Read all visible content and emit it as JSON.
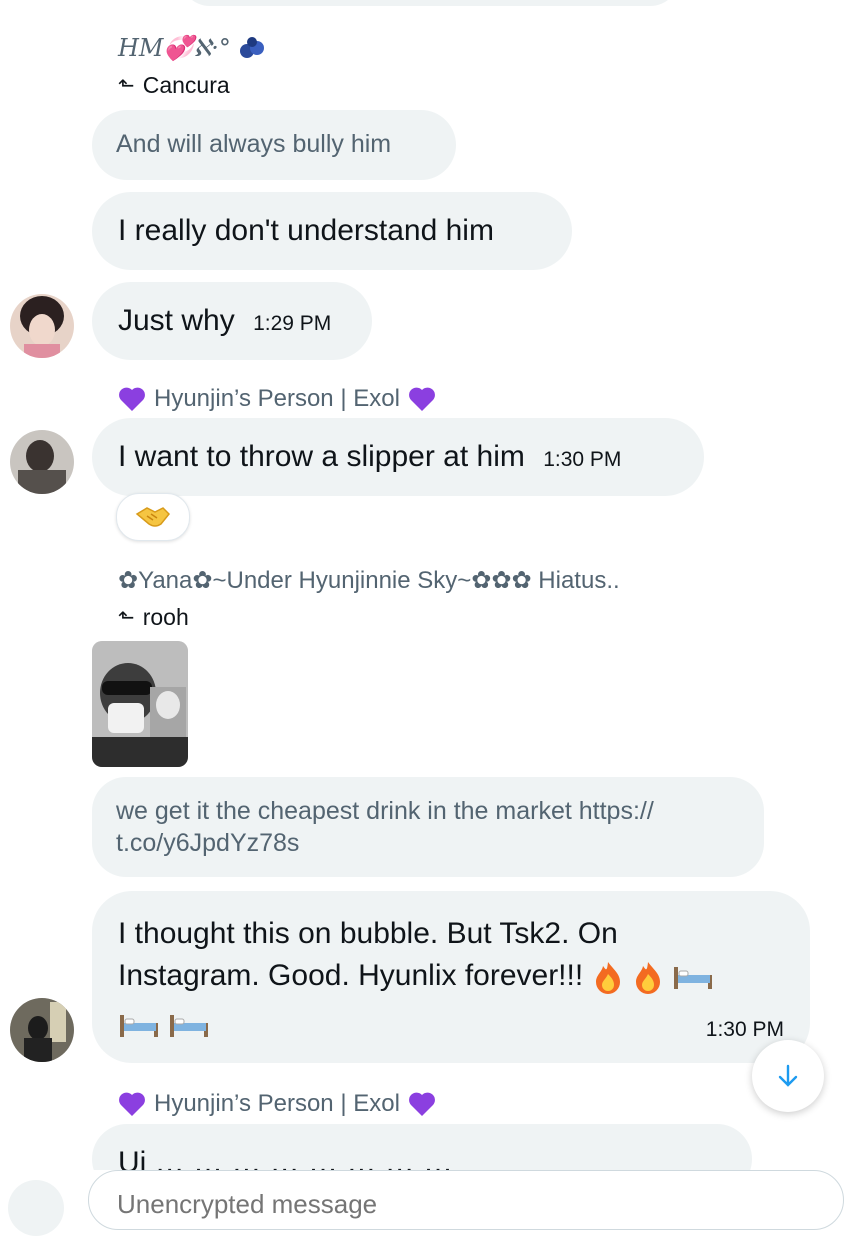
{
  "messages": {
    "m1": {
      "sender": "HM💞ℵ·°",
      "reply_to": "Cancura",
      "quoted": "And will always bully him"
    },
    "m2": {
      "text": "I really don't understand him"
    },
    "m3": {
      "text": "Just why",
      "time": "1:29 PM"
    },
    "m4": {
      "sender": "Hyunjin’s Person | Exol",
      "text": "I want to throw a slipper at him",
      "time": "1:30 PM",
      "reaction": "handshake-emoji"
    },
    "m5": {
      "sender": "✿Yana✿~Under Hyunjinnie Sky~✿✿✿ Hiatus..",
      "reply_to": "rooh",
      "quoted": "we get it the cheapest drink in the market https:// t.co/y6JpdYz78s"
    },
    "m6": {
      "line1": "I thought this on bubble. But Tsk2. On",
      "line2": "Instagram. Good. Hyunlix forever!!!",
      "time": "1:30 PM"
    },
    "m7": {
      "sender": "Hyunjin’s Person | Exol",
      "partial": "Ui … … … … … … … …"
    }
  },
  "composer": {
    "placeholder": "Unencrypted message"
  },
  "colors": {
    "bubble": "#eff3f4",
    "muted": "#536471",
    "accent": "#1d9bf0",
    "heart": "#8b3fe0"
  }
}
